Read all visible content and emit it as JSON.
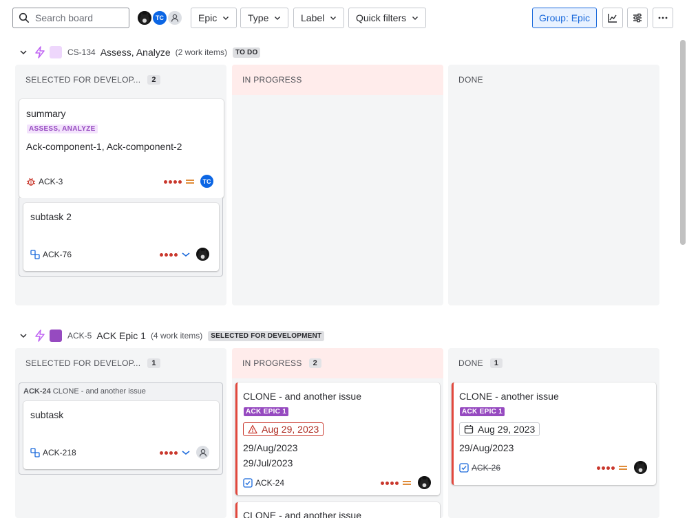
{
  "toolbar": {
    "search_placeholder": "Search board",
    "avatar_tc_initials": "TC",
    "filters": [
      "Epic",
      "Type",
      "Label",
      "Quick filters"
    ],
    "group_label": "Group: Epic"
  },
  "lanes": [
    {
      "epic_key": "CS-134",
      "epic_name": "Assess, Analyze",
      "count_text": "(2 work items)",
      "status": "TO DO",
      "swatch_color": "#eed7fc",
      "columns": [
        {
          "name": "SELECTED FOR DEVELOP...",
          "count": "2"
        },
        {
          "name": "IN PROGRESS",
          "count": ""
        },
        {
          "name": "DONE",
          "count": ""
        }
      ],
      "cards": [
        {
          "title": "summary",
          "epic_lozenge": "ASSESS, ANALYZE",
          "components": "Ack-component-1, Ack-component-2",
          "key": "ACK-3",
          "type_icon": "bug-icon",
          "priority": "medium",
          "assignee": "TC"
        },
        {
          "title": "subtask 2",
          "key": "ACK-76",
          "type_icon": "subtask-icon",
          "priority": "low",
          "assignee": "cat-avatar"
        }
      ]
    },
    {
      "epic_key": "ACK-5",
      "epic_name": "ACK Epic 1",
      "count_text": "(4 work items)",
      "status": "SELECTED FOR DEVELOPMENT",
      "swatch_color": "#964ac0",
      "columns": [
        {
          "name": "SELECTED FOR DEVELOP...",
          "count": "1"
        },
        {
          "name": "IN PROGRESS",
          "count": "2"
        },
        {
          "name": "DONE",
          "count": "1"
        }
      ],
      "parent_group": {
        "key": "ACK-24",
        "title": "CLONE - and another issue"
      },
      "cards": [
        {
          "title": "subtask",
          "key": "ACK-218",
          "type_icon": "subtask-icon",
          "priority": "low",
          "assignee": "default-avatar"
        },
        {
          "title": "CLONE - and another issue",
          "epic_lozenge": "ACK EPIC 1",
          "due_date": "Aug 29, 2023",
          "date1": "29/Aug/2023",
          "date2": "29/Jul/2023",
          "key": "ACK-24",
          "type_icon": "task-icon",
          "priority": "medium",
          "assignee": "cat-avatar"
        },
        {
          "title": "CLONE - another issue",
          "epic_lozenge": "ACK EPIC 1",
          "due_date": "Aug 29, 2023",
          "date1": "29/Aug/2023",
          "key": "ACK-26",
          "type_icon": "task-icon",
          "priority": "medium",
          "assignee": "cat-avatar"
        },
        {
          "title": "CLONE - and another issue"
        }
      ]
    }
  ],
  "colors": {
    "accent_blue": "#1868db",
    "epic_purple": "#964ac0",
    "priority_red": "#c9372c",
    "in_progress_bg": "#ffeceb"
  }
}
